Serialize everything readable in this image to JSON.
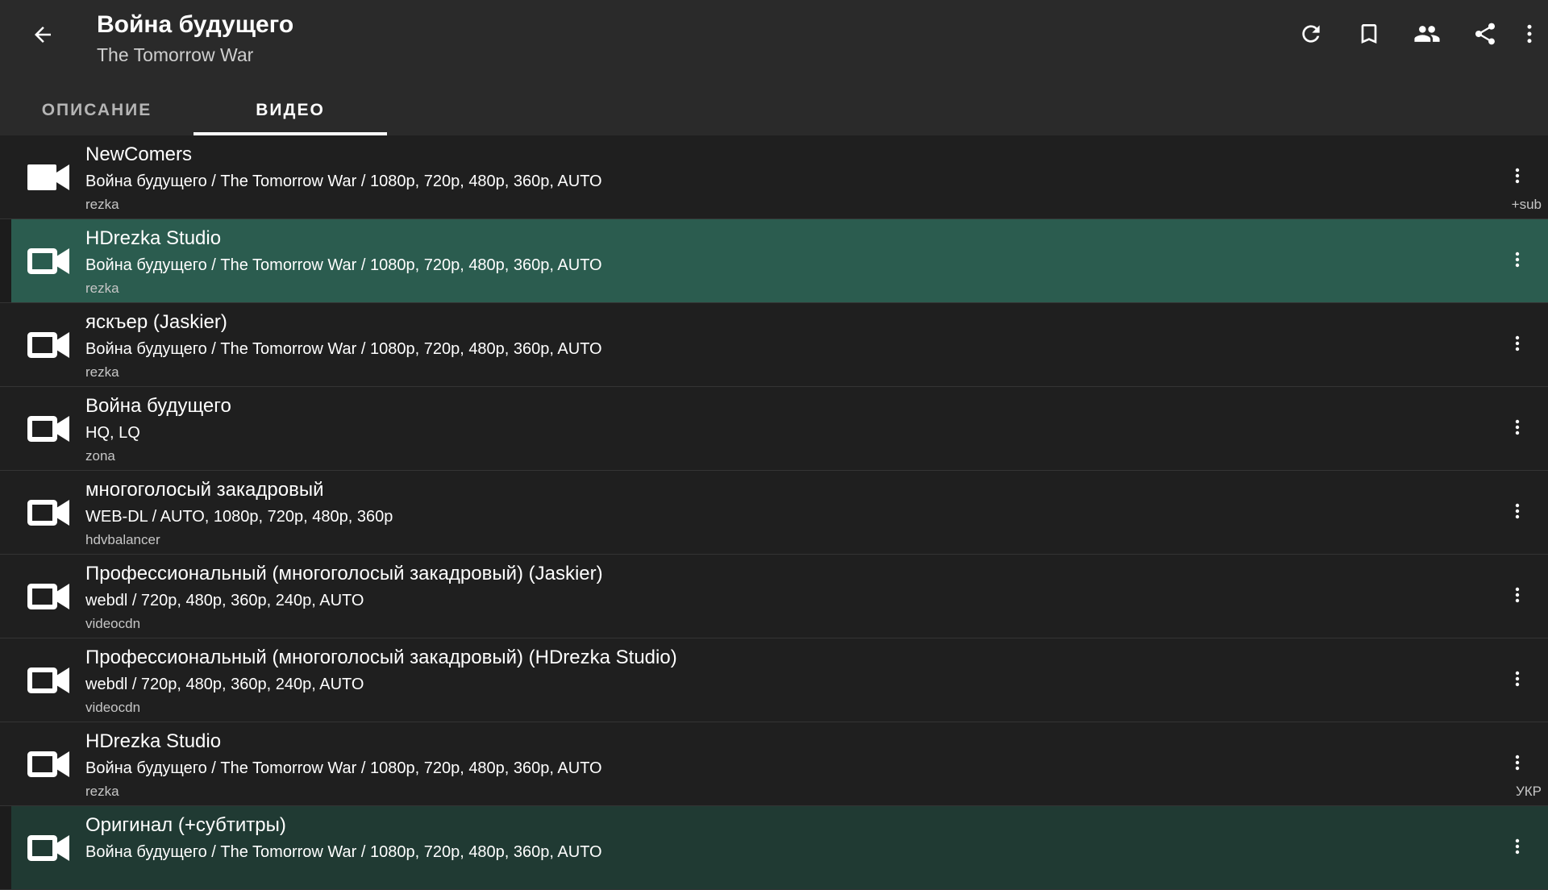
{
  "header": {
    "title": "Война будущего",
    "subtitle": "The Tomorrow War",
    "actions": [
      "refresh-icon",
      "bookmark-icon",
      "people-icon",
      "share-icon",
      "more-vert-icon"
    ]
  },
  "tabs": [
    {
      "label": "ОПИСАНИЕ",
      "active": false
    },
    {
      "label": "ВИДЕО",
      "active": true
    }
  ],
  "colors": {
    "background": "#1e1e1e",
    "appbar": "#2a2a2a",
    "selected_row": "#2b5c4f",
    "text": "#ffffff",
    "secondary_text": "#c6c6c6"
  },
  "videos": [
    {
      "title": "NewComers",
      "description": "Война будущего / The Tomorrow War / 1080p, 720p, 480p, 360p, AUTO",
      "source": "rezka",
      "tag": "+sub",
      "icon": "video-camera-filled-icon"
    },
    {
      "title": "HDrezka Studio",
      "description": "Война будущего / The Tomorrow War / 1080p, 720p, 480p, 360p, AUTO",
      "source": "rezka",
      "tag": "",
      "icon": "video-camera-icon",
      "selected": true
    },
    {
      "title": "яскъер (Jaskier)",
      "description": "Война будущего / The Tomorrow War / 1080p, 720p, 480p, 360p, AUTO",
      "source": "rezka",
      "tag": "",
      "icon": "video-camera-icon"
    },
    {
      "title": "Война будущего",
      "description": "HQ, LQ",
      "source": "zona",
      "tag": "",
      "icon": "video-camera-icon"
    },
    {
      "title": "многоголосый закадровый",
      "description": "WEB-DL / AUTO, 1080p, 720p, 480p, 360p",
      "source": "hdvbalancer",
      "tag": "",
      "icon": "video-camera-icon"
    },
    {
      "title": "Профессиональный (многоголосый закадровый) (Jaskier)",
      "description": "webdl / 720p, 480p, 360p, 240p, AUTO",
      "source": "videocdn",
      "tag": "",
      "icon": "video-camera-icon"
    },
    {
      "title": "Профессиональный (многоголосый закадровый) (HDrezka Studio)",
      "description": "webdl / 720p, 480p, 360p, 240p, AUTO",
      "source": "videocdn",
      "tag": "",
      "icon": "video-camera-icon"
    },
    {
      "title": "HDrezka Studio",
      "description": "Война будущего / The Tomorrow War / 1080p, 720p, 480p, 360p, AUTO",
      "source": "rezka",
      "tag": "УКР",
      "icon": "video-camera-icon"
    },
    {
      "title": "Оригинал (+субтитры)",
      "description": "Война будущего / The Tomorrow War / 1080p, 720p, 480p, 360p, AUTO",
      "source": "",
      "tag": "",
      "icon": "video-camera-icon"
    }
  ]
}
